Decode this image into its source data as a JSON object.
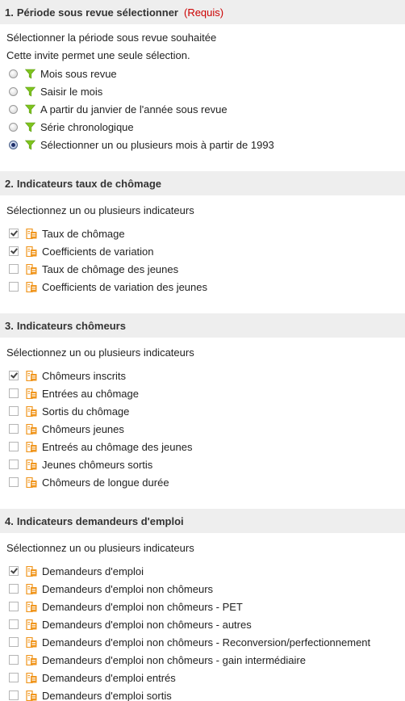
{
  "colors": {
    "header_bg": "#eeeeee",
    "required": "#cc0000",
    "filter_icon": "#7fc41e",
    "indicator_icon": "#f0961e"
  },
  "sections": [
    {
      "number": "1.",
      "title": "Période sous revue sélectionner",
      "required": "(Requis)",
      "prompts": [
        "Sélectionner la période sous revue souhaitée",
        "Cette invite permet une seule sélection."
      ],
      "control": "radio",
      "icon": "filter-icon",
      "options": [
        {
          "label": "Mois sous revue",
          "selected": false
        },
        {
          "label": "Saisir le mois",
          "selected": false
        },
        {
          "label": "A partir du janvier de l'année sous revue",
          "selected": false
        },
        {
          "label": "Série chronologique",
          "selected": false
        },
        {
          "label": "Sélectionner un ou plusieurs mois à partir de 1993",
          "selected": true
        }
      ]
    },
    {
      "number": "2.",
      "title": "Indicateurs taux de chômage",
      "prompts": [
        "Sélectionnez un ou plusieurs indicateurs"
      ],
      "control": "checkbox",
      "icon": "indicator-icon",
      "options": [
        {
          "label": "Taux de chômage",
          "selected": true
        },
        {
          "label": "Coefficients de variation",
          "selected": true
        },
        {
          "label": "Taux de chômage des jeunes",
          "selected": false
        },
        {
          "label": "Coefficients de variation des jeunes",
          "selected": false
        }
      ]
    },
    {
      "number": "3.",
      "title": "Indicateurs chômeurs",
      "prompts": [
        "Sélectionnez un ou plusieurs indicateurs"
      ],
      "control": "checkbox",
      "icon": "indicator-icon",
      "options": [
        {
          "label": "Chômeurs inscrits",
          "selected": true
        },
        {
          "label": "Entrées au chômage",
          "selected": false
        },
        {
          "label": "Sortis du chômage",
          "selected": false
        },
        {
          "label": "Chômeurs jeunes",
          "selected": false
        },
        {
          "label": "Entreés au chômage des jeunes",
          "selected": false
        },
        {
          "label": "Jeunes chômeurs sortis",
          "selected": false
        },
        {
          "label": "Chômeurs de longue durée",
          "selected": false
        }
      ]
    },
    {
      "number": "4.",
      "title": "Indicateurs demandeurs d'emploi",
      "prompts": [
        "Sélectionnez un ou plusieurs indicateurs"
      ],
      "control": "checkbox",
      "icon": "indicator-icon",
      "options": [
        {
          "label": "Demandeurs d'emploi",
          "selected": true
        },
        {
          "label": "Demandeurs d'emploi non chômeurs",
          "selected": false
        },
        {
          "label": "Demandeurs d'emploi non chômeurs - PET",
          "selected": false
        },
        {
          "label": "Demandeurs d'emploi non chômeurs - autres",
          "selected": false
        },
        {
          "label": "Demandeurs d'emploi non chômeurs - Reconversion/perfectionnement",
          "selected": false
        },
        {
          "label": "Demandeurs d'emploi non chômeurs - gain intermédiaire",
          "selected": false
        },
        {
          "label": "Demandeurs d'emploi entrés",
          "selected": false
        },
        {
          "label": "Demandeurs d'emploi sortis",
          "selected": false
        }
      ]
    }
  ]
}
